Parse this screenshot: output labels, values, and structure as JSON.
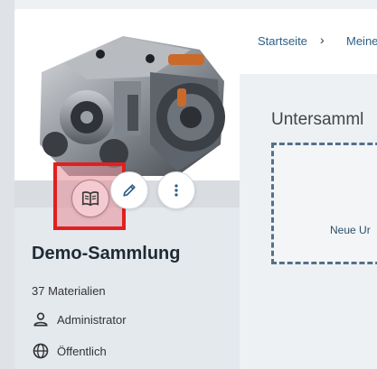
{
  "collection": {
    "title": "Demo-Sammlung",
    "materials_count": "37 Materialien",
    "owner": "Administrator",
    "visibility": "Öffentlich"
  },
  "actions": {
    "read": "book-icon",
    "edit": "pencil-icon",
    "more": "more-vertical-icon"
  },
  "breadcrumb": {
    "home": "Startseite",
    "current": "Meine"
  },
  "main": {
    "section_title": "Untersamml",
    "new_button": "Neue Ur"
  },
  "colors": {
    "highlight": "#e02020",
    "link": "#2d5f86"
  }
}
